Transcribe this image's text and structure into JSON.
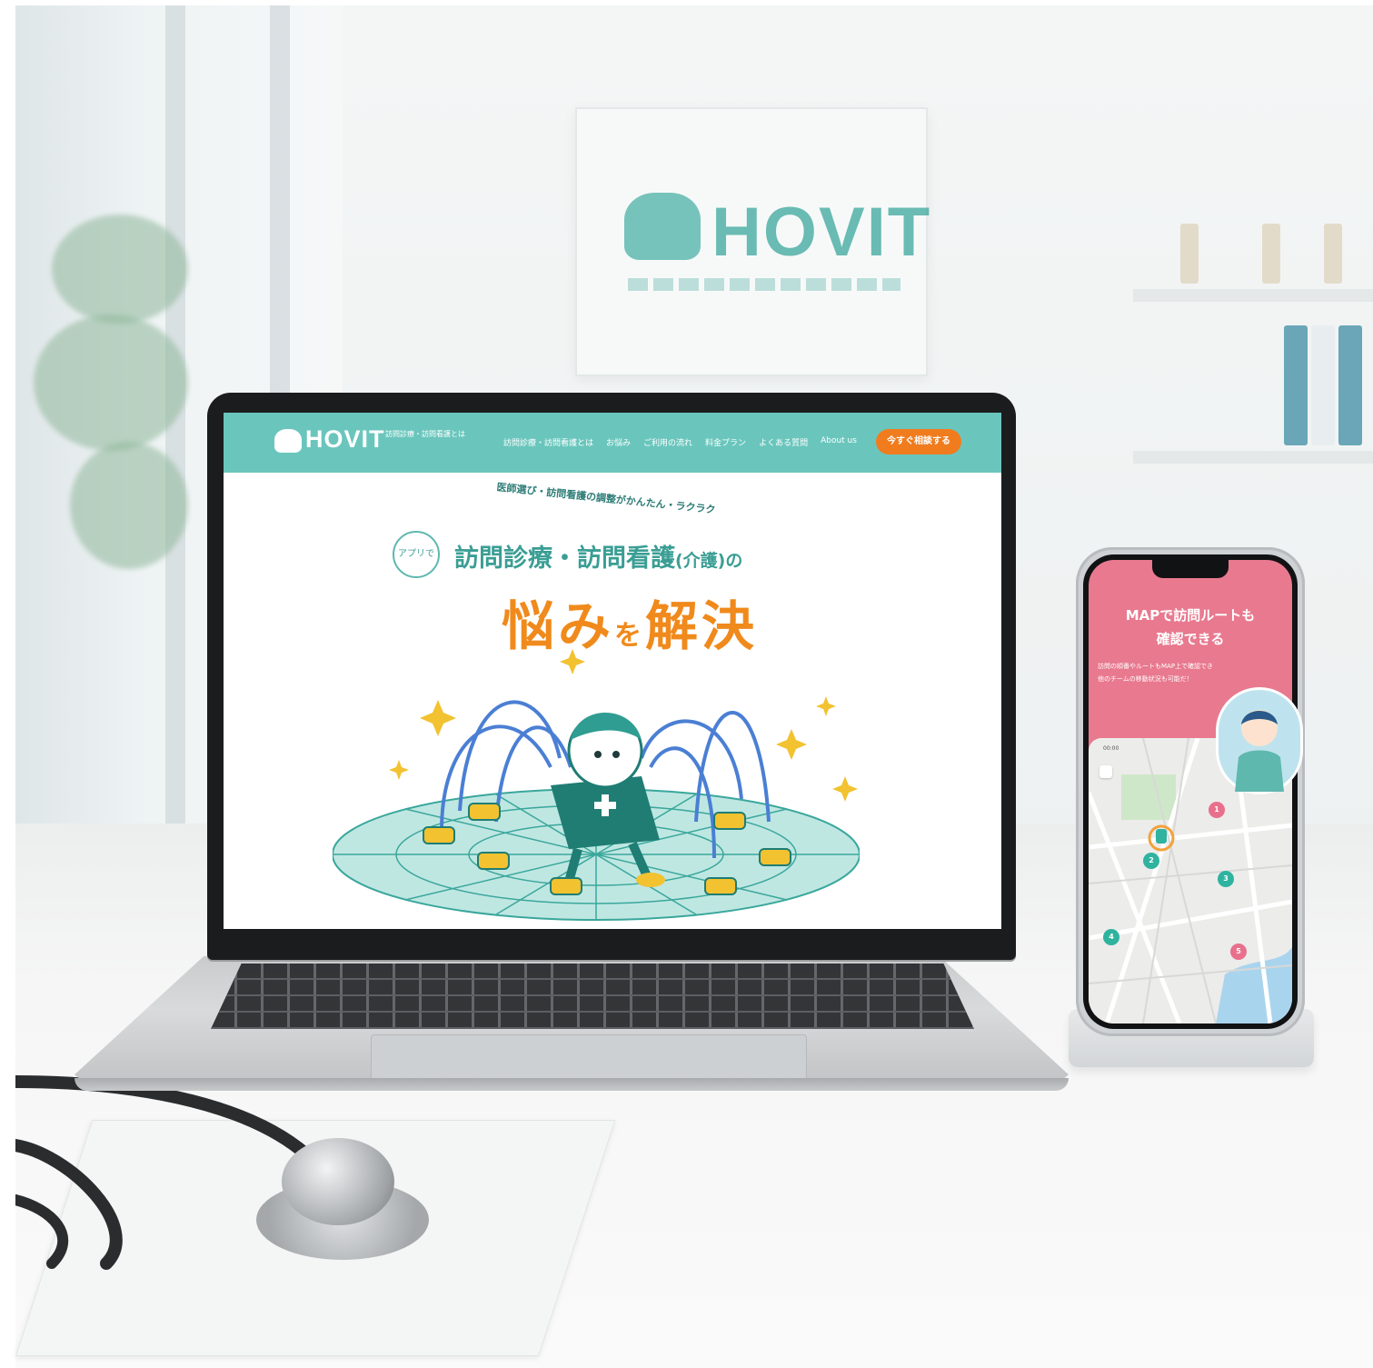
{
  "wall_sign": {
    "brand": "HOVIT"
  },
  "laptop_site": {
    "logo": "HOVIT",
    "tagline": "訪問診療・訪問看護とは",
    "nav": [
      "訪問診療・訪問看護とは",
      "お悩み",
      "ご利用の流れ",
      "料金プラン",
      "よくある質問",
      "About us"
    ],
    "cta_label": "今すぐ相談する",
    "arc_copy": "医師選び・訪問看護の調整がかんたん・ラクラク",
    "app_badge": "アプリで",
    "headline_main": "訪問診療・訪問看護",
    "headline_paren": "(介護)",
    "headline_end": "の",
    "solve_1": "悩み",
    "solve_wo": "を",
    "solve_2": "解決",
    "colors": {
      "header": "#6ac6bd",
      "cta": "#f07c1e",
      "headline": "#3a9e94",
      "solve": "#f08a1c"
    }
  },
  "phone": {
    "title": "MAPで訪問ルートも\n確認できる",
    "description": "訪問の順番やルートもMAP上で確認でき\n他のチームの移動状況も可能だ！",
    "time": "00:00",
    "pins": [
      "1",
      "2",
      "3",
      "4",
      "5"
    ],
    "colors": {
      "screen": "#e8798f",
      "pin_teal": "#2fb39f",
      "pin_pink": "#e8708c"
    }
  }
}
